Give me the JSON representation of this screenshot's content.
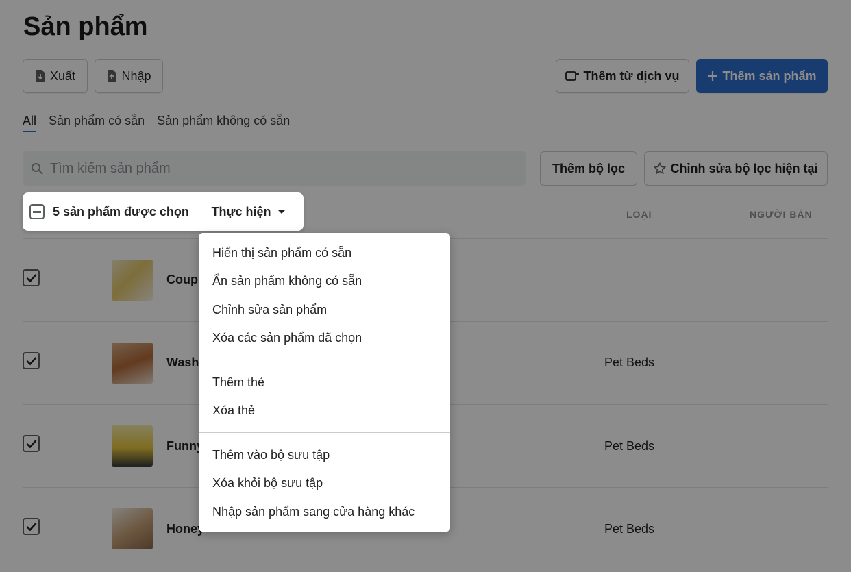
{
  "page": {
    "title": "Sản phẩm"
  },
  "toolbar": {
    "export_label": "Xuất",
    "import_label": "Nhập",
    "add_from_service_label": "Thêm từ dịch vụ",
    "add_product_label": "Thêm sản phẩm"
  },
  "tabs": [
    {
      "label": "All",
      "active": true
    },
    {
      "label": "Sản phẩm có sẵn",
      "active": false
    },
    {
      "label": "Sản phẩm không có sẵn",
      "active": false
    }
  ],
  "search": {
    "placeholder": "Tìm kiếm sản phẩm",
    "value": ""
  },
  "filters": {
    "add_filter_label": "Thêm bộ lọc",
    "edit_filter_label": "Chỉnh sửa bộ lọc hiện tại"
  },
  "bulk": {
    "selected_label": "5 sản phẩm được chọn",
    "action_label": "Thực hiện"
  },
  "columns": {
    "type": "LOẠI",
    "vendor": "NGƯỜI BÁN"
  },
  "products": [
    {
      "name": "Coupl",
      "type": "",
      "checked": true
    },
    {
      "name": "Wash",
      "type": "Pet Beds",
      "checked": true
    },
    {
      "name": "Funny",
      "type": "Pet Beds",
      "checked": true
    },
    {
      "name": "Honey",
      "type": "Pet Beds",
      "checked": true
    }
  ],
  "menu": {
    "items": [
      "Hiển thị sản phẩm có sẵn",
      "Ẩn sản phẩm không có sẵn",
      "Chỉnh sửa sản phẩm",
      "Xóa các sản phẩm đã chọn",
      "Thêm thẻ",
      "Xóa thẻ",
      "Thêm vào bộ sưu tập",
      "Xóa khỏi bộ sưu tập",
      "Nhập sản phẩm sang cửa hàng khác"
    ]
  },
  "colors": {
    "accent": "#2c6ecb",
    "overlay": "rgba(0,0,0,0.45)"
  }
}
